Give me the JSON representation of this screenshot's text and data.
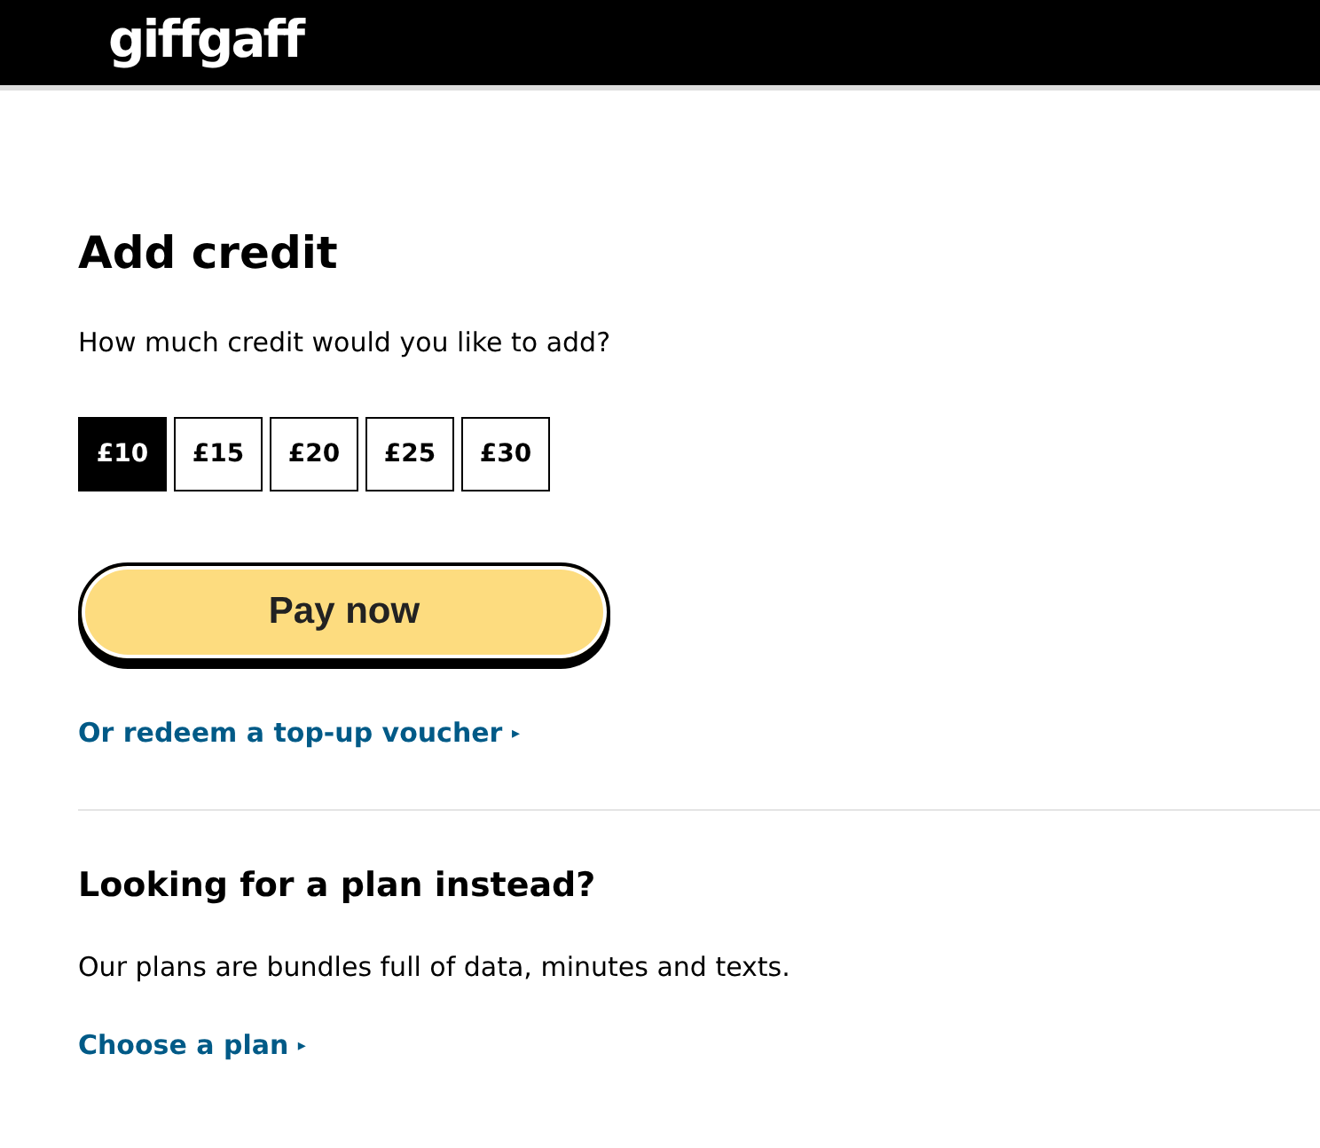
{
  "header": {
    "logo": "giffgaff"
  },
  "title": "Add credit",
  "question": "How much credit would you like to add?",
  "amounts": [
    {
      "label": "£10",
      "selected": true
    },
    {
      "label": "£15",
      "selected": false
    },
    {
      "label": "£20",
      "selected": false
    },
    {
      "label": "£25",
      "selected": false
    },
    {
      "label": "£30",
      "selected": false
    }
  ],
  "pay_button": "Pay now",
  "voucher_link": {
    "label": "Or redeem a top-up voucher",
    "arrow": "▸"
  },
  "plan_section": {
    "heading": "Looking for a plan instead?",
    "text": "Our plans are bundles full of data, minutes and texts.",
    "link": {
      "label": "Choose a plan",
      "arrow": "▸"
    }
  }
}
